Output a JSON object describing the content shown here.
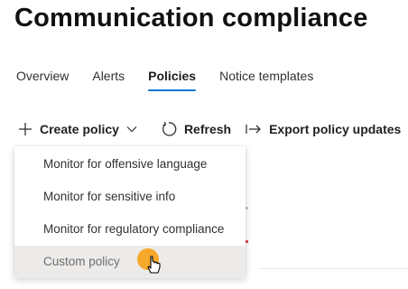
{
  "page": {
    "title": "Communication compliance"
  },
  "tabs": [
    {
      "label": "Overview",
      "active": false
    },
    {
      "label": "Alerts",
      "active": false
    },
    {
      "label": "Policies",
      "active": true
    },
    {
      "label": "Notice templates",
      "active": false
    }
  ],
  "toolbar": {
    "create_label": "Create policy",
    "create_icon": "plus-icon",
    "chevron_icon": "chevron-down-icon",
    "refresh_label": "Refresh",
    "refresh_icon": "refresh-icon",
    "export_label": "Export policy updates",
    "export_icon": "export-arrow-icon"
  },
  "dropdown": {
    "items": [
      {
        "label": "Monitor for offensive language",
        "hovered": false
      },
      {
        "label": "Monitor for sensitive info",
        "hovered": false
      },
      {
        "label": "Monitor for regulatory compliance",
        "hovered": false
      },
      {
        "label": "Custom policy",
        "hovered": true
      }
    ]
  },
  "colors": {
    "accent": "#0078d4",
    "cursor_highlight": "#f7a520",
    "hover_bg": "#edebe9"
  }
}
